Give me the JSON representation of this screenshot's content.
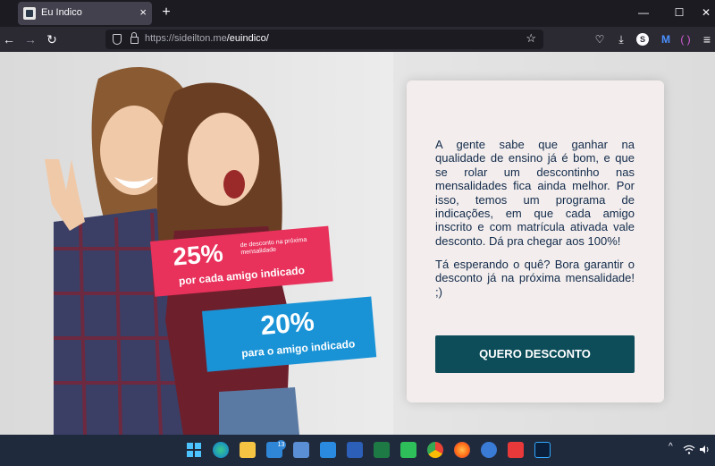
{
  "browser": {
    "tab_title": "Eu Indico",
    "url_host": "https://sideilton.me",
    "url_path": "/euindico/",
    "tab_close_glyph": "×",
    "new_tab_glyph": "+",
    "minimize_glyph": "—",
    "maximize_glyph": "☐",
    "close_glyph": "✕",
    "back_glyph": "←",
    "forward_glyph": "→",
    "reload_glyph": "↻",
    "star_glyph": "☆",
    "avatar_letter": "S",
    "menu_glyph": "≡",
    "pocket_glyph": "♡",
    "download_glyph": "⤓",
    "ext1_glyph": "M",
    "ext2_glyph": "( )"
  },
  "hero": {
    "badge1_percent": "25%",
    "badge1_small": "de desconto na próxima mensalidade",
    "badge1_caption": "por cada amigo indicado",
    "badge2_percent": "20%",
    "badge2_caption": "para o amigo indicado",
    "badge1_color": "#e8315b",
    "badge2_color": "#1a93d6"
  },
  "card": {
    "paragraph1": "A gente sabe que ganhar na qualidade de ensino já é bom, e que se rolar um descontinho nas mensalidades fica ainda melhor. Por isso, temos um programa de indicações, em que cada amigo inscrito e com matrícula ativada vale desconto. Dá pra chegar aos 100%!",
    "paragraph2": "Tá esperando o quê? Bora garantir o desconto já na próxima mensalidade! ;)",
    "button_label": "QUERO DESCONTO",
    "button_color": "#0d4d5a",
    "text_color": "#11294a"
  },
  "taskbar": {
    "mail_badge": "13",
    "apps": [
      "windows-start",
      "edge",
      "file-explorer",
      "mail",
      "photos",
      "visual-studio-code",
      "word",
      "excel",
      "whatsapp",
      "chrome",
      "firefox",
      "thunderbird",
      "anydesk",
      "photoshop"
    ],
    "tray_glyphs": [
      "^",
      "wifi",
      "speaker"
    ]
  }
}
